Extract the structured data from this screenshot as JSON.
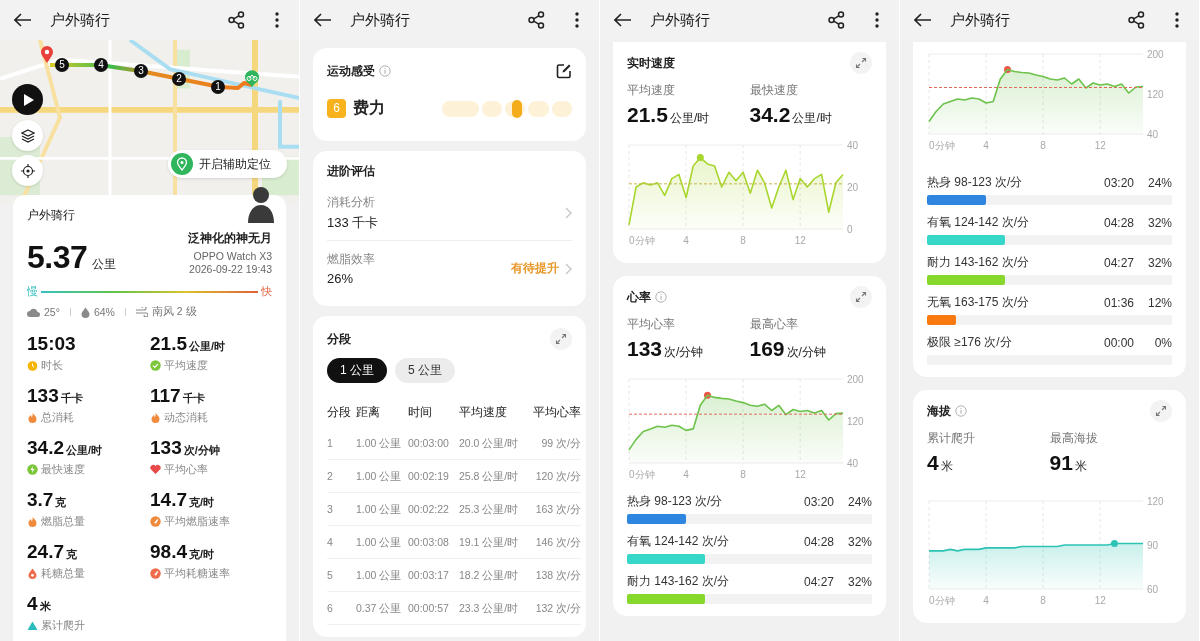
{
  "route_screen": {
    "header": {
      "title": "户外骑行"
    },
    "map": {
      "markers": [
        "5",
        "4",
        "3",
        "2",
        "1"
      ],
      "assist_button": "开启辅助定位"
    },
    "summary": {
      "title": "户外骑行",
      "distance": "5.37",
      "distance_unit": "公里",
      "user_name": "泛神化的神无月",
      "device": "OPPO Watch X3",
      "datetime": "2026-09-22 19:43",
      "pace_slow": "慢",
      "pace_fast": "快",
      "weather": [
        {
          "kind": "cloud",
          "text": "25°"
        },
        {
          "kind": "humidity",
          "text": "64%"
        },
        {
          "kind": "wind",
          "text": "南风 2 级"
        }
      ],
      "stats": [
        {
          "value": "15:03",
          "label": "时长",
          "color": "#f4b400"
        },
        {
          "value": "21.5",
          "unit": "公里/时",
          "label": "平均速度",
          "color": "#7cc63a"
        },
        {
          "value": "133",
          "unit": "千卡",
          "label": "总消耗",
          "color": "#f08a3c"
        },
        {
          "value": "117",
          "unit": "千卡",
          "label": "动态消耗",
          "color": "#f08a3c"
        },
        {
          "value": "34.2",
          "unit": "公里/时",
          "label": "最快速度",
          "color": "#7cc63a"
        },
        {
          "value": "133",
          "unit": "次/分钟",
          "label": "平均心率",
          "color": "#e84a4a"
        },
        {
          "value": "3.7",
          "unit": "克",
          "label": "燃脂总量",
          "color": "#f08a3c"
        },
        {
          "value": "14.7",
          "unit": "克/时",
          "label": "平均燃脂速率",
          "color": "#f08a3c"
        },
        {
          "value": "24.7",
          "unit": "克",
          "label": "耗糖总量",
          "color": "#ef6c4a"
        },
        {
          "value": "98.4",
          "unit": "克/时",
          "label": "平均耗糖速率",
          "color": "#ef6c4a"
        },
        {
          "value": "4",
          "unit": "米",
          "label": "累计爬升",
          "color": "#2bbdbd"
        }
      ]
    }
  },
  "evaluation_screen": {
    "header": {
      "title": "户外骑行"
    },
    "feeling": {
      "title": "运动感受",
      "score": "6",
      "label": "费力",
      "level": 0.58
    },
    "advanced": {
      "title": "进阶评估",
      "rows": [
        {
          "label": "消耗分析",
          "value": "133 千卡"
        },
        {
          "label": "燃脂效率",
          "value": "26%",
          "status": "有待提升"
        }
      ]
    },
    "splits": {
      "title": "分段",
      "tabs": [
        {
          "label": "1 公里",
          "selected": true
        },
        {
          "label": "5 公里",
          "selected": false
        }
      ],
      "columns": [
        "分段",
        "距离",
        "时间",
        "平均速度",
        "平均心率"
      ],
      "rows": [
        [
          "1",
          "1.00 公里",
          "00:03:00",
          "20.0 公里/时",
          "99 次/分"
        ],
        [
          "2",
          "1.00 公里",
          "00:02:19",
          "25.8 公里/时",
          "120 次/分"
        ],
        [
          "3",
          "1.00 公里",
          "00:02:22",
          "25.3 公里/时",
          "163 次/分"
        ],
        [
          "4",
          "1.00 公里",
          "00:03:08",
          "19.1 公里/时",
          "146 次/分"
        ],
        [
          "5",
          "1.00 公里",
          "00:03:17",
          "18.2 公里/时",
          "138 次/分"
        ],
        [
          "6",
          "0.37 公里",
          "00:00:57",
          "23.3 公里/时",
          "132 次/分"
        ]
      ]
    }
  },
  "speed_screen": {
    "header": {
      "title": "户外骑行"
    },
    "speed": {
      "title": "实时速度",
      "stats": [
        {
          "label": "平均速度",
          "value": "21.5",
          "unit": "公里/时"
        },
        {
          "label": "最快速度",
          "value": "34.2",
          "unit": "公里/时"
        }
      ],
      "chart_data": {
        "type": "area",
        "x": [
          0,
          0.5,
          1,
          1.5,
          2,
          2.5,
          3,
          3.5,
          4,
          4.5,
          5,
          5.5,
          6,
          6.5,
          7,
          7.5,
          8,
          8.5,
          9,
          9.5,
          10,
          10.5,
          11,
          11.5,
          12,
          12.5,
          13,
          13.5,
          14,
          14.5,
          15
        ],
        "series": [
          {
            "color": "#a8d62e",
            "values": [
              2,
              20,
              22,
              21,
              22,
              16,
              24,
              26,
              15,
              30,
              34,
              31,
              30,
              20,
              27,
              23,
              27,
              17,
              28,
              22,
              10,
              20,
              28,
              14,
              24,
              20,
              24,
              26,
              8,
              22,
              26
            ]
          }
        ],
        "xlim": [
          0,
          15
        ],
        "ylim": [
          0,
          40
        ],
        "xticks": [
          {
            "value": 0,
            "label": "0分钟"
          },
          4,
          8,
          12
        ],
        "yticks": [
          0,
          20,
          40
        ],
        "grid": true,
        "ref_lines": [
          {
            "axis": "y",
            "value": 21.5
          }
        ]
      }
    },
    "heart": {
      "title": "心率",
      "stats": [
        {
          "label": "平均心率",
          "value": "133",
          "unit": "次/分钟"
        },
        {
          "label": "最高心率",
          "value": "169",
          "unit": "次/分钟"
        }
      ],
      "chart_data": {
        "type": "area",
        "x": [
          0,
          0.5,
          1,
          1.5,
          2,
          2.5,
          3,
          3.5,
          4,
          4.5,
          5,
          5.5,
          6,
          6.5,
          7,
          7.5,
          8,
          8.5,
          9,
          9.5,
          10,
          10.5,
          11,
          11.5,
          12,
          12.5,
          13,
          13.5,
          14,
          14.5,
          15
        ],
        "series": [
          {
            "color": "#6cc24a",
            "values": [
              65,
              85,
              100,
              105,
              110,
              108,
              112,
              110,
              102,
              105,
              150,
              169,
              165,
              163,
              162,
              158,
              155,
              150,
              148,
              152,
              140,
              150,
              132,
              142,
              138,
              140,
              135,
              140,
              122,
              134,
              135
            ]
          }
        ],
        "xlim": [
          0,
          15
        ],
        "ylim": [
          40,
          200
        ],
        "xticks": [
          {
            "value": 0,
            "label": "0分钟"
          },
          4,
          8,
          12
        ],
        "yticks": [
          40,
          120,
          200
        ],
        "grid": true,
        "ref_lines": [
          {
            "axis": "y",
            "value": 133
          }
        ]
      },
      "zones": [
        {
          "name": "热身 98-123 次/分",
          "time": "03:20",
          "percent": "24%",
          "level": 0.24,
          "color": "#2f86e0"
        },
        {
          "name": "有氧 124-142 次/分",
          "time": "04:28",
          "percent": "32%",
          "level": 0.32,
          "color": "#36d6c8"
        },
        {
          "name": "耐力 143-162 次/分",
          "time": "04:27",
          "percent": "32%",
          "level": 0.32,
          "color": "#86d82a"
        }
      ]
    }
  },
  "heart_screen": {
    "header": {
      "title": "户外骑行"
    },
    "heart": {
      "chart_data": {
        "type": "area",
        "x": [
          0,
          0.5,
          1,
          1.5,
          2,
          2.5,
          3,
          3.5,
          4,
          4.5,
          5,
          5.5,
          6,
          6.5,
          7,
          7.5,
          8,
          8.5,
          9,
          9.5,
          10,
          10.5,
          11,
          11.5,
          12,
          12.5,
          13,
          13.5,
          14,
          14.5,
          15
        ],
        "series": [
          {
            "color": "#6cc24a",
            "values": [
              65,
              85,
              100,
              105,
              110,
              108,
              112,
              110,
              102,
              105,
              150,
              169,
              165,
              163,
              162,
              158,
              155,
              150,
              148,
              152,
              140,
              150,
              132,
              142,
              138,
              140,
              135,
              140,
              122,
              134,
              135
            ]
          }
        ],
        "xlim": [
          0,
          15
        ],
        "ylim": [
          40,
          200
        ],
        "xticks": [
          {
            "value": 0,
            "label": "0分钟"
          },
          4,
          8,
          12
        ],
        "yticks": [
          40,
          120,
          200
        ],
        "grid": true,
        "ref_lines": [
          {
            "axis": "y",
            "value": 133
          }
        ]
      },
      "zones": [
        {
          "name": "热身 98-123 次/分",
          "time": "03:20",
          "percent": "24%",
          "level": 0.24,
          "color": "#2f86e0"
        },
        {
          "name": "有氧 124-142 次/分",
          "time": "04:28",
          "percent": "32%",
          "level": 0.32,
          "color": "#36d6c8"
        },
        {
          "name": "耐力 143-162 次/分",
          "time": "04:27",
          "percent": "32%",
          "level": 0.32,
          "color": "#86d82a"
        },
        {
          "name": "无氧 163-175 次/分",
          "time": "01:36",
          "percent": "12%",
          "level": 0.12,
          "color": "#f7790f"
        },
        {
          "name": "极限 ≥176 次/分",
          "time": "00:00",
          "percent": "0%",
          "level": 0
        }
      ]
    },
    "altitude": {
      "title": "海拔",
      "stats": [
        {
          "label": "累计爬升",
          "value": "4",
          "unit": "米"
        },
        {
          "label": "最高海拔",
          "value": "91",
          "unit": "米"
        }
      ],
      "chart_data": {
        "type": "area",
        "x": [
          0,
          0.5,
          1,
          1.5,
          2,
          2.5,
          3,
          3.5,
          4,
          4.5,
          5,
          5.5,
          6,
          6.5,
          7,
          7.5,
          8,
          8.5,
          9,
          9.5,
          10,
          10.5,
          11,
          11.5,
          12,
          12.5,
          13,
          13.5,
          14,
          14.5,
          15
        ],
        "series": [
          {
            "color": "#2cc3b5",
            "values": [
              86,
              86,
              86,
              87,
              86,
              87,
              87,
              87,
              88,
              88,
              88,
              88,
              88,
              89,
              89,
              89,
              89,
              89,
              89,
              90,
              90,
              90,
              90,
              90,
              90,
              90,
              91,
              91,
              91,
              91,
              91
            ]
          }
        ],
        "xlim": [
          0,
          15
        ],
        "ylim": [
          60,
          120
        ],
        "xticks": [
          {
            "value": 0,
            "label": "0分钟"
          },
          4,
          8,
          12
        ],
        "yticks": [
          60,
          90,
          120
        ],
        "grid": true
      }
    }
  }
}
